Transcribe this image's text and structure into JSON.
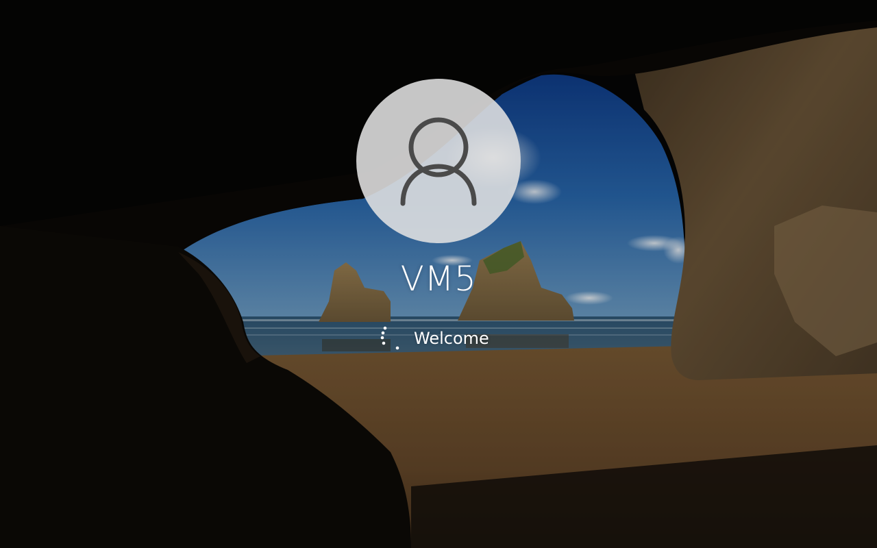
{
  "screen": {
    "type": "Windows sign-in screen",
    "state": "signing in"
  },
  "user": {
    "name": "VM5",
    "avatar_icon": "user-silhouette-icon"
  },
  "status": {
    "text": "Welcome",
    "spinner_icon": "loading-spinner-icon"
  },
  "colors": {
    "text": "#ffffff",
    "avatar_bg": "#e1e1e1",
    "avatar_icon": "#555555"
  }
}
